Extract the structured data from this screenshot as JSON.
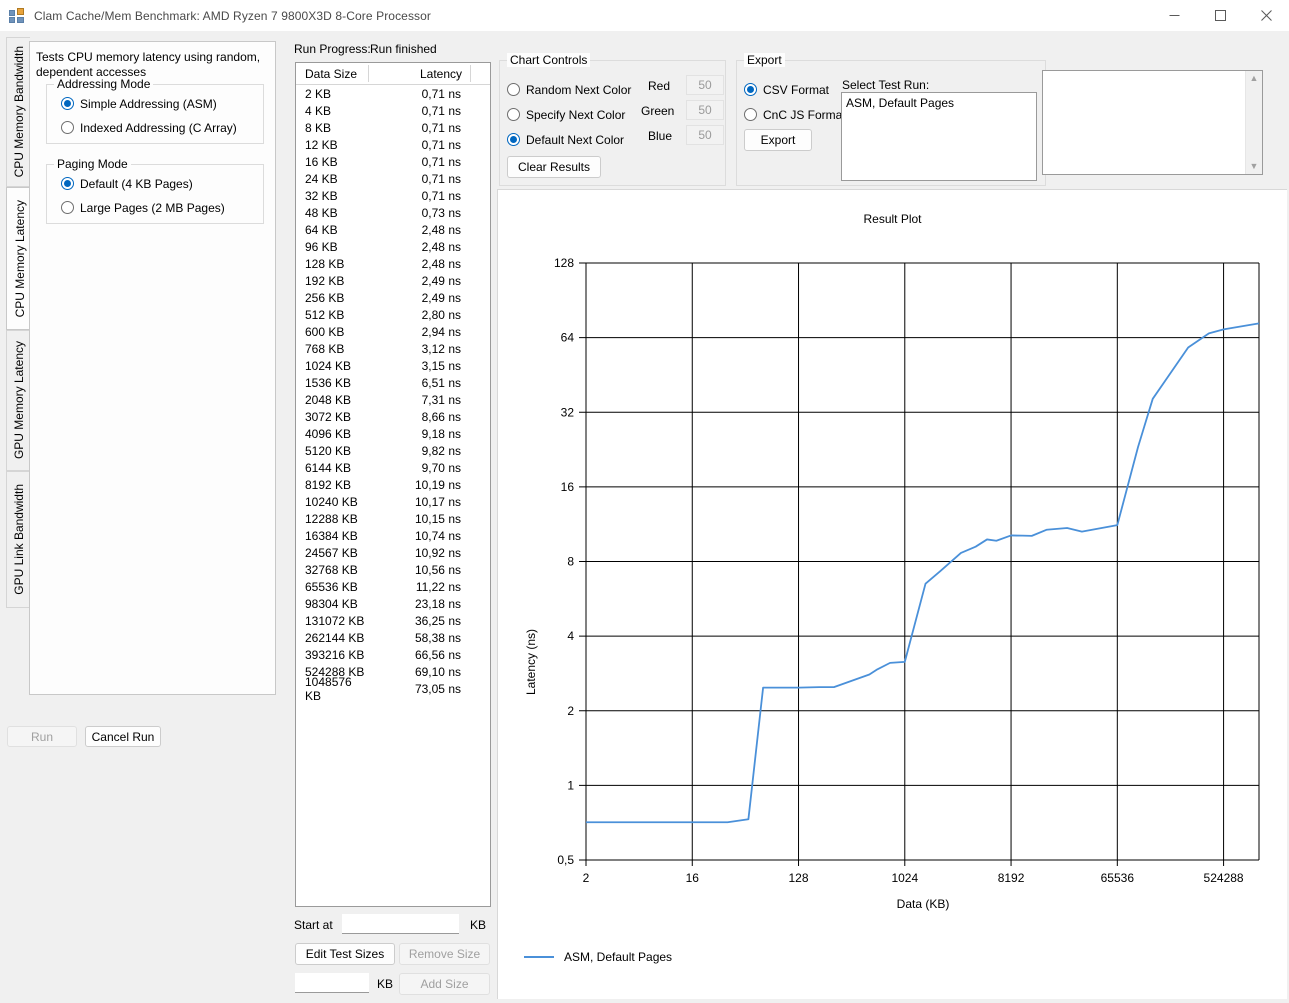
{
  "window": {
    "title": "Clam Cache/Mem Benchmark: AMD Ryzen 7 9800X3D 8-Core Processor",
    "app_icon": "app-icon",
    "minimize": "—",
    "maximize": "□",
    "close": "✕"
  },
  "vertical_tabs": [
    {
      "label": "CPU Memory Bandwidth",
      "selected": false
    },
    {
      "label": "CPU Memory Latency",
      "selected": true
    },
    {
      "label": "GPU Memory Latency",
      "selected": false
    },
    {
      "label": "GPU Link Bandwidth",
      "selected": false
    }
  ],
  "left_panel": {
    "description": "Tests CPU memory latency using random, dependent accesses",
    "addressing_mode": {
      "title": "Addressing Mode",
      "options": [
        {
          "label": "Simple Addressing (ASM)",
          "selected": true
        },
        {
          "label": "Indexed Addressing (C Array)",
          "selected": false
        }
      ]
    },
    "paging_mode": {
      "title": "Paging Mode",
      "options": [
        {
          "label": "Default (4 KB Pages)",
          "selected": true
        },
        {
          "label": "Large Pages (2 MB Pages)",
          "selected": false
        }
      ]
    },
    "run_button": {
      "label": "Run",
      "enabled": false
    },
    "cancel_button": {
      "label": "Cancel Run",
      "enabled": true
    }
  },
  "run_progress": {
    "label": "Run Progress:",
    "status": "Run finished"
  },
  "results_table": {
    "columns": [
      "Data Size",
      "Latency"
    ],
    "rows": [
      [
        "2 KB",
        "0,71 ns"
      ],
      [
        "4 KB",
        "0,71 ns"
      ],
      [
        "8 KB",
        "0,71 ns"
      ],
      [
        "12 KB",
        "0,71 ns"
      ],
      [
        "16 KB",
        "0,71 ns"
      ],
      [
        "24 KB",
        "0,71 ns"
      ],
      [
        "32 KB",
        "0,71 ns"
      ],
      [
        "48 KB",
        "0,73 ns"
      ],
      [
        "64 KB",
        "2,48 ns"
      ],
      [
        "96 KB",
        "2,48 ns"
      ],
      [
        "128 KB",
        "2,48 ns"
      ],
      [
        "192 KB",
        "2,49 ns"
      ],
      [
        "256 KB",
        "2,49 ns"
      ],
      [
        "512 KB",
        "2,80 ns"
      ],
      [
        "600 KB",
        "2,94 ns"
      ],
      [
        "768 KB",
        "3,12 ns"
      ],
      [
        "1024 KB",
        "3,15 ns"
      ],
      [
        "1536 KB",
        "6,51 ns"
      ],
      [
        "2048 KB",
        "7,31 ns"
      ],
      [
        "3072 KB",
        "8,66 ns"
      ],
      [
        "4096 KB",
        "9,18 ns"
      ],
      [
        "5120 KB",
        "9,82 ns"
      ],
      [
        "6144 KB",
        "9,70 ns"
      ],
      [
        "8192 KB",
        "10,19 ns"
      ],
      [
        "10240 KB",
        "10,17 ns"
      ],
      [
        "12288 KB",
        "10,15 ns"
      ],
      [
        "16384 KB",
        "10,74 ns"
      ],
      [
        "24567 KB",
        "10,92 ns"
      ],
      [
        "32768 KB",
        "10,56 ns"
      ],
      [
        "65536 KB",
        "11,22 ns"
      ],
      [
        "98304 KB",
        "23,18 ns"
      ],
      [
        "131072 KB",
        "36,25 ns"
      ],
      [
        "262144 KB",
        "58,38 ns"
      ],
      [
        "393216 KB",
        "66,56 ns"
      ],
      [
        "524288 KB",
        "69,10 ns"
      ],
      [
        "1048576 KB",
        "73,05 ns"
      ]
    ]
  },
  "size_controls": {
    "start_at_label": "Start at",
    "start_at_value": "",
    "start_at_unit": "KB",
    "edit_test_sizes": {
      "label": "Edit Test Sizes",
      "enabled": true
    },
    "remove_size": {
      "label": "Remove Size",
      "enabled": false
    },
    "add_size_value": "",
    "add_size_unit": "KB",
    "add_size": {
      "label": "Add Size",
      "enabled": false
    }
  },
  "chart_controls": {
    "title": "Chart Controls",
    "options": [
      {
        "label": "Random Next Color",
        "selected": false
      },
      {
        "label": "Specify Next Color",
        "selected": false
      },
      {
        "label": "Default Next Color",
        "selected": true
      }
    ],
    "color_fields": [
      {
        "label": "Red",
        "value": "50"
      },
      {
        "label": "Green",
        "value": "50"
      },
      {
        "label": "Blue",
        "value": "50"
      }
    ],
    "clear_results": {
      "label": "Clear Results",
      "enabled": true
    }
  },
  "export": {
    "title": "Export",
    "options": [
      {
        "label": "CSV Format",
        "selected": true
      },
      {
        "label": "CnC JS Format",
        "selected": false
      }
    ],
    "export_button": {
      "label": "Export",
      "enabled": true
    },
    "select_test_run_label": "Select Test Run:",
    "test_runs": [
      "ASM, Default Pages"
    ],
    "log_text": ""
  },
  "colors": {
    "series": "#4a90d9",
    "accent": "#0067c0",
    "grid": "#000000",
    "panel": "#f0f0f0"
  },
  "chart_data": {
    "type": "line",
    "title": "Result Plot",
    "xlabel": "Data (KB)",
    "ylabel": "Latency (ns)",
    "xscale": "log",
    "yscale": "log",
    "xlim": [
      2,
      1048576
    ],
    "ylim": [
      0.5,
      128
    ],
    "xticks": [
      2,
      16,
      128,
      1024,
      8192,
      65536,
      524288
    ],
    "xtick_labels": [
      "2",
      "16",
      "128",
      "1024",
      "8192",
      "65536",
      "524288"
    ],
    "yticks": [
      0.5,
      1,
      2,
      4,
      8,
      16,
      32,
      64,
      128
    ],
    "ytick_labels": [
      "0,5",
      "1",
      "2",
      "4",
      "8",
      "16",
      "32",
      "64",
      "128"
    ],
    "grid": true,
    "legend_position": "below",
    "series": [
      {
        "name": "ASM, Default Pages",
        "color": "#4a90d9",
        "x": [
          2,
          4,
          8,
          12,
          16,
          24,
          32,
          48,
          64,
          96,
          128,
          192,
          256,
          512,
          600,
          768,
          1024,
          1536,
          2048,
          3072,
          4096,
          5120,
          6144,
          8192,
          10240,
          12288,
          16384,
          24567,
          32768,
          65536,
          98304,
          131072,
          262144,
          393216,
          524288,
          1048576
        ],
        "y": [
          0.71,
          0.71,
          0.71,
          0.71,
          0.71,
          0.71,
          0.71,
          0.73,
          2.48,
          2.48,
          2.48,
          2.49,
          2.49,
          2.8,
          2.94,
          3.12,
          3.15,
          6.51,
          7.31,
          8.66,
          9.18,
          9.82,
          9.7,
          10.19,
          10.17,
          10.15,
          10.74,
          10.92,
          10.56,
          11.22,
          23.18,
          36.25,
          58.38,
          66.56,
          69.1,
          73.05
        ]
      }
    ]
  }
}
